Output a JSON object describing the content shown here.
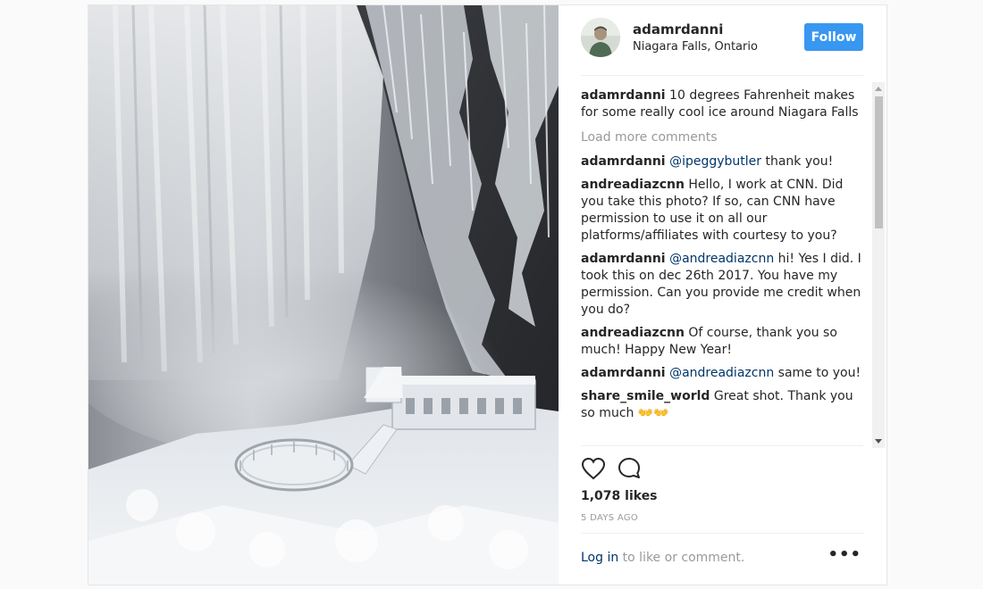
{
  "post": {
    "username": "adamrdanni",
    "location": "Niagara Falls, Ontario",
    "follow_label": "Follow",
    "photo_description": "",
    "avatar_icon": "user-avatar"
  },
  "caption": {
    "author": "adamrdanni",
    "text": " 10 degrees Fahrenheit makes for some really cool ice around Niagara Falls"
  },
  "load_more_label": "Load more comments",
  "comments": [
    {
      "author": "adamrdanni",
      "mention": "@ipeggybutler",
      "text": " thank you!"
    },
    {
      "author": "andreadiazcnn",
      "mention": "",
      "text": " Hello, I work at CNN. Did you take this photo? If so, can CNN have permission to use it on all our platforms/affiliates with courtesy to you?"
    },
    {
      "author": "adamrdanni",
      "mention": "@andreadiazcnn",
      "text": " hi! Yes I did. I took this on dec 26th 2017. You have my permission. Can you provide me credit when you do?"
    },
    {
      "author": "andreadiazcnn",
      "mention": "",
      "text": " Of course, thank you so much! Happy New Year!"
    },
    {
      "author": "adamrdanni",
      "mention": "@andreadiazcnn",
      "text": " same to you!"
    },
    {
      "author": "share_smile_world",
      "mention": "",
      "text": " Great shot. Thank you so much 👐👐"
    }
  ],
  "actions": {
    "like_icon": "heart-outline",
    "comment_icon": "speech-bubble-outline"
  },
  "likes_text": "1,078 likes",
  "timestamp": "5 DAYS AGO",
  "login": {
    "link_text": "Log in",
    "rest_text": " to like or comment."
  },
  "more_options": "•••",
  "colors": {
    "follow_bg": "#3897f0",
    "mention": "#003569",
    "muted": "#999999",
    "text": "#262626"
  }
}
